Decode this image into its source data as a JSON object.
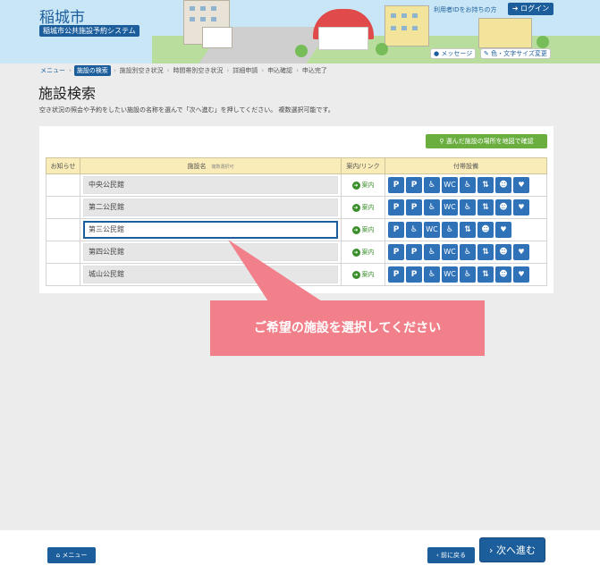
{
  "header": {
    "city_name": "稲城市",
    "system_name": "稲城市公共施設予約システム",
    "user_id_text": "利用者IDをお持ちの方",
    "login_label": "ログイン",
    "message_label": "メッセージ",
    "color_font_label": "色・文字サイズ変更"
  },
  "breadcrumb": {
    "items": [
      {
        "label": "メニュー"
      },
      {
        "label": "施設の検索"
      },
      {
        "label": "施設別空き状況"
      },
      {
        "label": "時間帯別空き状況"
      },
      {
        "label": "詳細申請"
      },
      {
        "label": "申込確認"
      },
      {
        "label": "申込完了"
      }
    ]
  },
  "page": {
    "title": "施設検索",
    "instruction": "空き状況の照会や予約をしたい施設の名称を選んで「次へ進む」を押してください。 複数選択可能です。"
  },
  "map_button_label": "選んだ施設の場所を地図で確認",
  "table": {
    "headers": {
      "notice": "お知らせ",
      "name": "施設名",
      "name_sub": "複数選択可",
      "link": "案内/リンク",
      "amenities": "付帯設備"
    },
    "link_label": "案内",
    "rows": [
      {
        "name": "中央公民館",
        "selected": false
      },
      {
        "name": "第二公民館",
        "selected": false
      },
      {
        "name": "第三公民館",
        "selected": true
      },
      {
        "name": "第四公民館",
        "selected": false
      },
      {
        "name": "城山公民館",
        "selected": false
      }
    ]
  },
  "callout_text": "ご希望の施設を選択してください",
  "footer": {
    "menu_label": "メニュー",
    "back_label": "前に戻る",
    "next_label": "次へ進む"
  },
  "colors": {
    "primary": "#1c5e9c",
    "green": "#6aae3f",
    "callout": "#f1808a",
    "header_yellow": "#f9ecb8"
  }
}
